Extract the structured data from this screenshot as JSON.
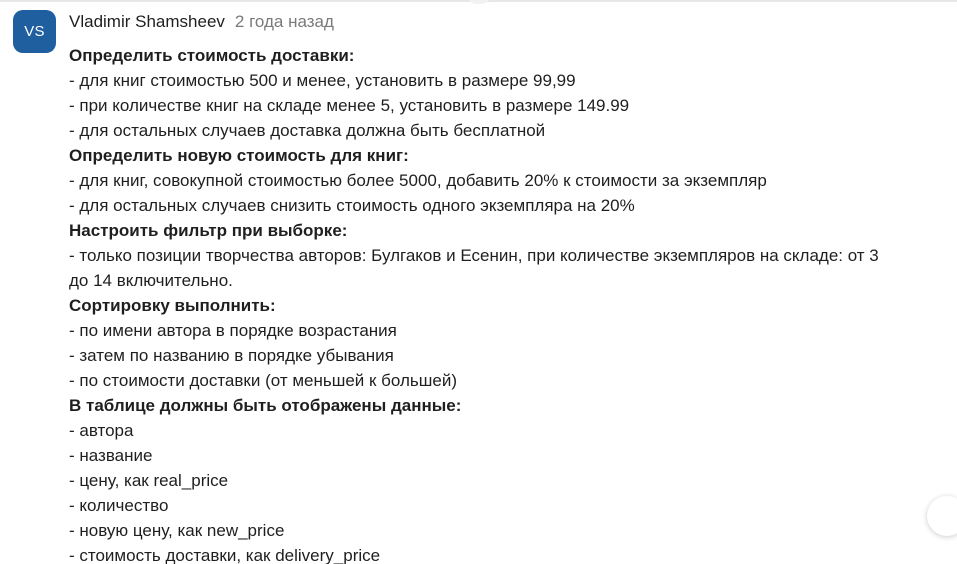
{
  "comment": {
    "avatar_initials": "VS",
    "author": "Vladimir Shamsheev",
    "timestamp": "2 года назад",
    "lines": {
      "h1": "Определить стоимость доставки:",
      "l1": "- для книг стоимостью 500 и менее, установить в размере 99,99",
      "l2": "- при количестве книг на складе менее 5, установить в размере 149.99",
      "l3": "- для остальных случаев доставка должна быть бесплатной",
      "h2": "Определить новую стоимость для книг:",
      "l4": "- для книг, совокупной стоимостью более 5000, добавить 20% к стоимости за экземпляр",
      "l5": "- для остальных случаев снизить стоимость одного экземпляра на 20%",
      "h3": "Настроить фильтр при выборке:",
      "l6": "- только позиции творчества авторов: Булгаков и Есенин, при количестве экземпляров на складе: от 3",
      "l7": "до 14 включительно.",
      "h4": "Сортировку выполнить:",
      "l8": "- по имени автора в порядке возрастания",
      "l9": "- затем по названию в порядке убывания",
      "l10": "- по стоимости доставки (от меньшей к большей)",
      "h5": "В таблице должны быть отображены данные:",
      "l11": "- автора",
      "l12": "- название",
      "l13": "- цену, как real_price",
      "l14": "- количество",
      "l15": "- новую цену, как new_price",
      "l16": "- стоимость доставки, как delivery_price"
    }
  },
  "colors": {
    "avatar_bg": "#1f5fa0",
    "text": "#1f1f1f",
    "muted": "#7a7a7a"
  }
}
